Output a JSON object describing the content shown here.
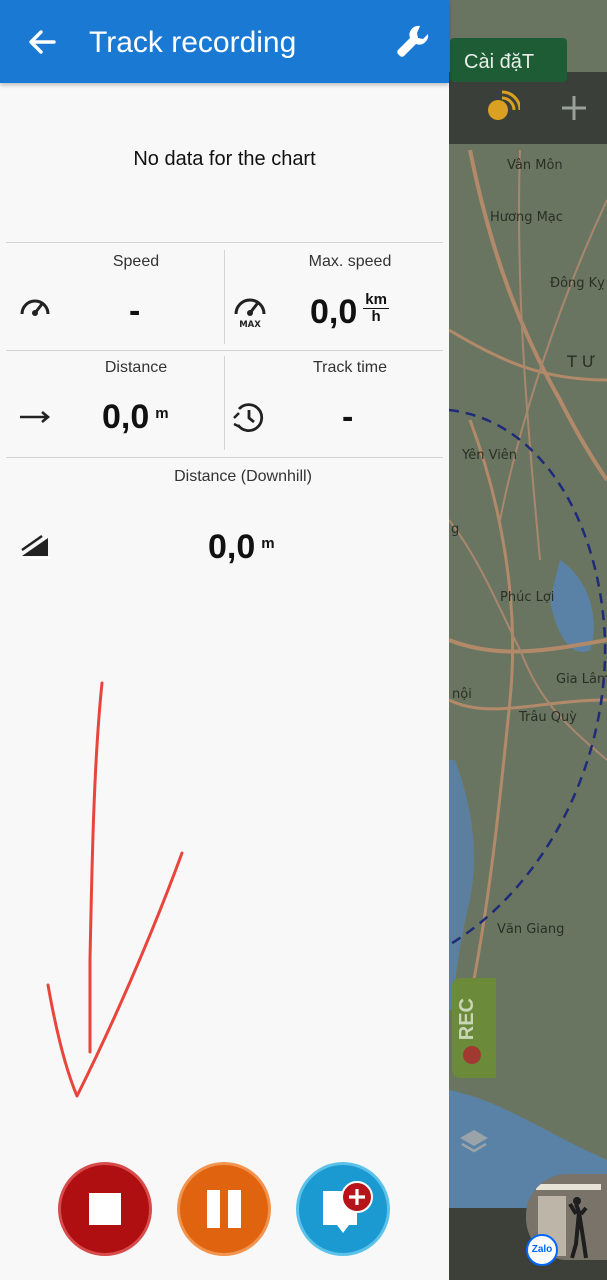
{
  "app": {
    "title": "Track recording"
  },
  "chart": {
    "empty_message": "No data for the chart"
  },
  "stats": {
    "speed": {
      "label": "Speed",
      "value": "-"
    },
    "max_speed": {
      "label": "Max. speed",
      "value": "0,0",
      "unit_num": "km",
      "unit_den": "h",
      "icon_badge": "MAX"
    },
    "distance": {
      "label": "Distance",
      "value": "0,0",
      "unit": "m"
    },
    "track_time": {
      "label": "Track time",
      "value": "-"
    },
    "distance_downhill": {
      "label": "Distance (Downhill)",
      "value": "0,0",
      "unit": "m"
    }
  },
  "actions": {
    "stop": {
      "icon": "stop-icon",
      "color": "#b00f12"
    },
    "pause": {
      "icon": "pause-icon",
      "color": "#e0630f"
    },
    "add_poi": {
      "icon": "add-waypoint-icon",
      "color": "#1b9ad1"
    }
  },
  "map": {
    "settings_chip": "Cài đặT",
    "rec_tab": "REC",
    "places": [
      "Vân Môn",
      "Hương Mạc",
      "Đông Kỵ",
      "T Ư",
      "Yên Viên",
      "Phúc Lợi",
      "Gia Lâm",
      "Trâu Quỳ",
      "Văn Giang",
      "nội",
      "g"
    ],
    "zalo_badge": "Zalo"
  },
  "colors": {
    "appbar": "#1a7ad3",
    "panel_bg": "#f8f8f8",
    "annotation_arrow": "#e8453c"
  }
}
